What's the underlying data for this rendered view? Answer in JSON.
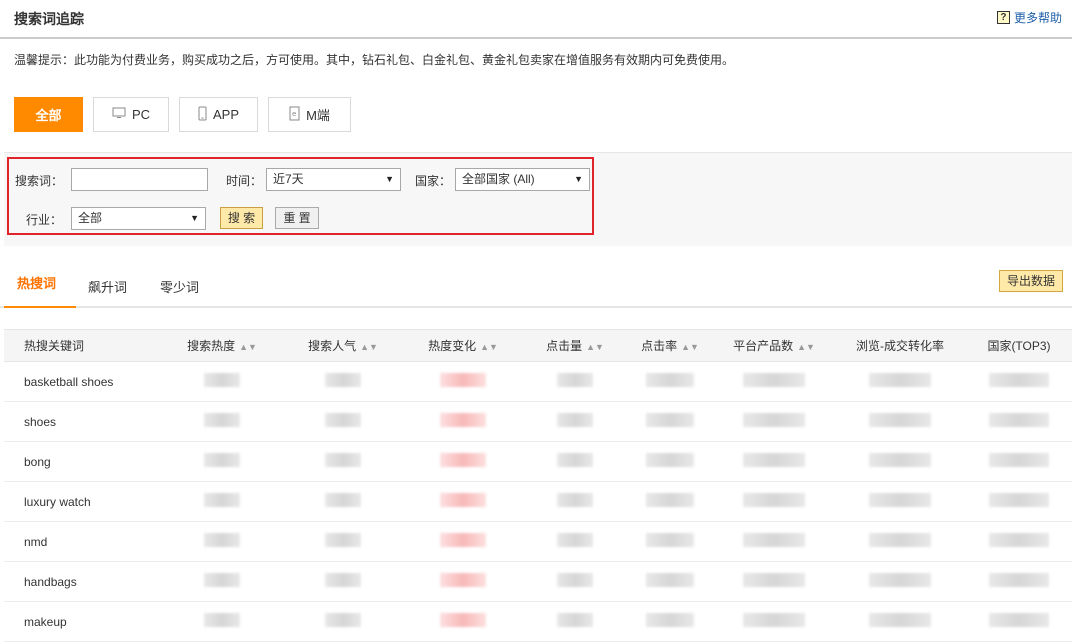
{
  "header": {
    "title": "搜索词追踪",
    "help_icon": "question-mark-icon",
    "help_label": "更多帮助"
  },
  "tip": "温馨提示：此功能为付费业务，购买成功之后，方可使用。其中，钻石礼包、白金礼包、黄金礼包卖家在增值服务有效期内可免费使用。",
  "device_tabs": [
    {
      "label": "全部",
      "icon": "",
      "active": true
    },
    {
      "label": "PC",
      "icon": "monitor-icon",
      "active": false
    },
    {
      "label": "APP",
      "icon": "phone-icon",
      "active": false
    },
    {
      "label": "M端",
      "icon": "mobile-browser-icon",
      "active": false
    }
  ],
  "filters": {
    "search_label": "搜索词：",
    "search_value": "",
    "time_label": "时间：",
    "time_value": "近7天",
    "country_label": "国家：",
    "country_value": "全部国家 (All)",
    "industry_label": "行业：",
    "industry_value": "全部",
    "search_button": "搜 索",
    "reset_button": "重 置"
  },
  "word_tabs": [
    {
      "label": "热搜词",
      "active": true
    },
    {
      "label": "飙升词",
      "active": false
    },
    {
      "label": "零少词",
      "active": false
    }
  ],
  "export_button": "导出数据",
  "table": {
    "columns": [
      "热搜关键词",
      "搜索热度",
      "搜索人气",
      "热度变化",
      "点击量",
      "点击率",
      "平台产品数",
      "浏览-成交转化率",
      "国家(TOP3)"
    ],
    "rows": [
      "basketball shoes",
      "shoes",
      "bong",
      "luxury watch",
      "nmd",
      "handbags",
      "makeup"
    ]
  },
  "colors": {
    "accent": "#ff8a00",
    "highlight_box": "#e0242a",
    "link": "#1f5fa8"
  }
}
